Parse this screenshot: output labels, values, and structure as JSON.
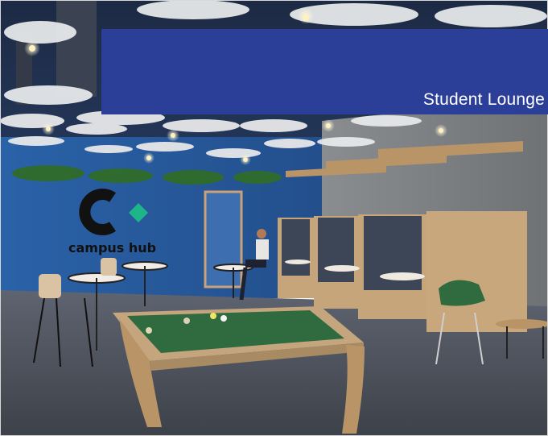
{
  "image": {
    "description": "3D render of a student lounge with blue wall, pool table, booths and pendant lights"
  },
  "banner": {
    "title": "Student Lounge"
  },
  "wall_logo": {
    "brand": "campus hub"
  },
  "colors": {
    "banner_bg": "#2b3f99",
    "wall_blue": "#2a5fa0",
    "felt_green": "#2f6b3e",
    "logo_accent": "#1fb58a"
  }
}
